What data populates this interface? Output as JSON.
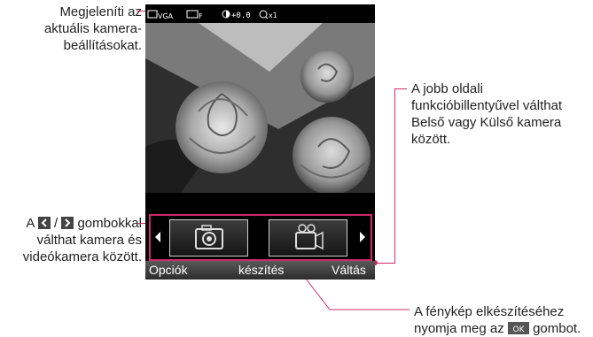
{
  "annotations": {
    "top_left": [
      "Megjeleníti az",
      "aktuális kamera-",
      "beállításokat."
    ],
    "right": [
      "A jobb oldali",
      "funkcióbillentyűvel válthat",
      "Belső vagy Külső kamera",
      "között."
    ],
    "left_prefix": "A",
    "left_slash": "/",
    "left_suffix": "gombokkal",
    "left_rest": [
      "válthat kamera és",
      "videókamera között."
    ],
    "bottom_line1": "A fénykép elkészítéséhez",
    "bottom_pre": "nyomja meg az",
    "bottom_post": "gombot."
  },
  "status_bar": {
    "resolution": "VGA",
    "quality": "F",
    "exposure": "+0.0",
    "zoom": "x1"
  },
  "mode_bar": {
    "modes": [
      "camera",
      "video-camera"
    ],
    "selected": "camera"
  },
  "softkeys": {
    "left": "Opciók",
    "center": "készítés",
    "right": "Váltás"
  },
  "keys": {
    "ok_label": "OK"
  },
  "colors": {
    "accent": "#d12a6a",
    "screen_bg": "#000000"
  },
  "icons": [
    "camera-icon",
    "video-camera-icon",
    "left-key-icon",
    "right-key-icon",
    "ok-key-icon"
  ]
}
